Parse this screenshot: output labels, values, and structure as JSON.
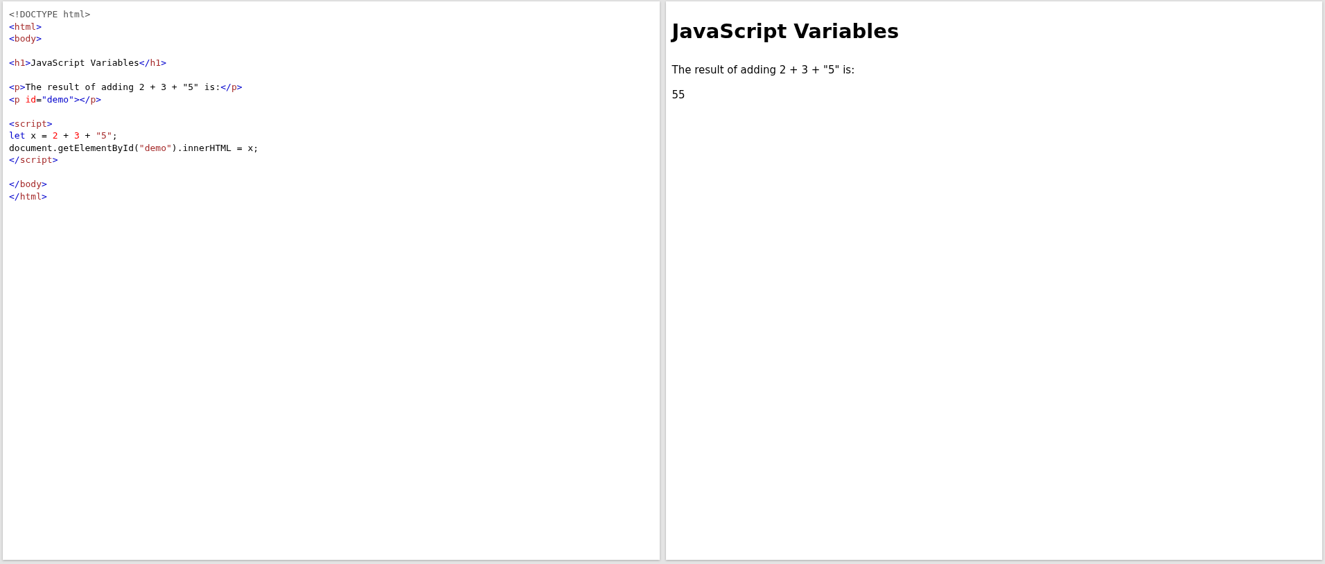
{
  "editor": {
    "lines": [
      {
        "kind": "code",
        "tokens": [
          {
            "kind": "doctype",
            "text": "<!DOCTYPE html>"
          }
        ]
      },
      {
        "kind": "code",
        "tokens": [
          {
            "kind": "bracket",
            "text": "<"
          },
          {
            "kind": "tag",
            "text": "html"
          },
          {
            "kind": "bracket",
            "text": ">"
          }
        ]
      },
      {
        "kind": "code",
        "tokens": [
          {
            "kind": "bracket",
            "text": "<"
          },
          {
            "kind": "tag",
            "text": "body"
          },
          {
            "kind": "bracket",
            "text": ">"
          }
        ]
      },
      {
        "kind": "blank"
      },
      {
        "kind": "code",
        "tokens": [
          {
            "kind": "bracket",
            "text": "<"
          },
          {
            "kind": "tag",
            "text": "h1"
          },
          {
            "kind": "bracket",
            "text": ">"
          },
          {
            "kind": "text",
            "text": "JavaScript Variables"
          },
          {
            "kind": "bracket",
            "text": "</"
          },
          {
            "kind": "tag",
            "text": "h1"
          },
          {
            "kind": "bracket",
            "text": ">"
          }
        ]
      },
      {
        "kind": "blank"
      },
      {
        "kind": "code",
        "tokens": [
          {
            "kind": "bracket",
            "text": "<"
          },
          {
            "kind": "tag",
            "text": "p"
          },
          {
            "kind": "bracket",
            "text": ">"
          },
          {
            "kind": "text",
            "text": "The result of adding 2 + 3 + \"5\" is:"
          },
          {
            "kind": "bracket",
            "text": "</"
          },
          {
            "kind": "tag",
            "text": "p"
          },
          {
            "kind": "bracket",
            "text": ">"
          }
        ]
      },
      {
        "kind": "code",
        "tokens": [
          {
            "kind": "bracket",
            "text": "<"
          },
          {
            "kind": "tag",
            "text": "p"
          },
          {
            "kind": "attr",
            "text": " id"
          },
          {
            "kind": "text",
            "text": "="
          },
          {
            "kind": "value",
            "text": "\"demo\""
          },
          {
            "kind": "bracket",
            "text": "></"
          },
          {
            "kind": "tag",
            "text": "p"
          },
          {
            "kind": "bracket",
            "text": ">"
          }
        ]
      },
      {
        "kind": "blank"
      },
      {
        "kind": "code",
        "tokens": [
          {
            "kind": "bracket",
            "text": "<"
          },
          {
            "kind": "tag",
            "text": "script"
          },
          {
            "kind": "bracket",
            "text": ">"
          }
        ]
      },
      {
        "kind": "code",
        "tokens": [
          {
            "kind": "keyword",
            "text": "let"
          },
          {
            "kind": "text",
            "text": " x = "
          },
          {
            "kind": "number",
            "text": "2"
          },
          {
            "kind": "text",
            "text": " + "
          },
          {
            "kind": "number",
            "text": "3"
          },
          {
            "kind": "text",
            "text": " + "
          },
          {
            "kind": "string",
            "text": "\"5\""
          },
          {
            "kind": "text",
            "text": ";"
          }
        ]
      },
      {
        "kind": "code",
        "tokens": [
          {
            "kind": "text",
            "text": "document.getElementById("
          },
          {
            "kind": "string",
            "text": "\"demo\""
          },
          {
            "kind": "text",
            "text": ").innerHTML = x;"
          }
        ]
      },
      {
        "kind": "code",
        "tokens": [
          {
            "kind": "bracket",
            "text": "</"
          },
          {
            "kind": "tag",
            "text": "script"
          },
          {
            "kind": "bracket",
            "text": ">"
          }
        ]
      },
      {
        "kind": "blank"
      },
      {
        "kind": "code",
        "tokens": [
          {
            "kind": "bracket",
            "text": "</"
          },
          {
            "kind": "tag",
            "text": "body"
          },
          {
            "kind": "bracket",
            "text": ">"
          }
        ]
      },
      {
        "kind": "code",
        "tokens": [
          {
            "kind": "bracket",
            "text": "</"
          },
          {
            "kind": "tag",
            "text": "html"
          },
          {
            "kind": "bracket",
            "text": ">"
          }
        ]
      }
    ]
  },
  "result": {
    "heading": "JavaScript Variables",
    "paragraphs": [
      "The result of adding 2 + 3 + \"5\" is:",
      "55"
    ]
  }
}
